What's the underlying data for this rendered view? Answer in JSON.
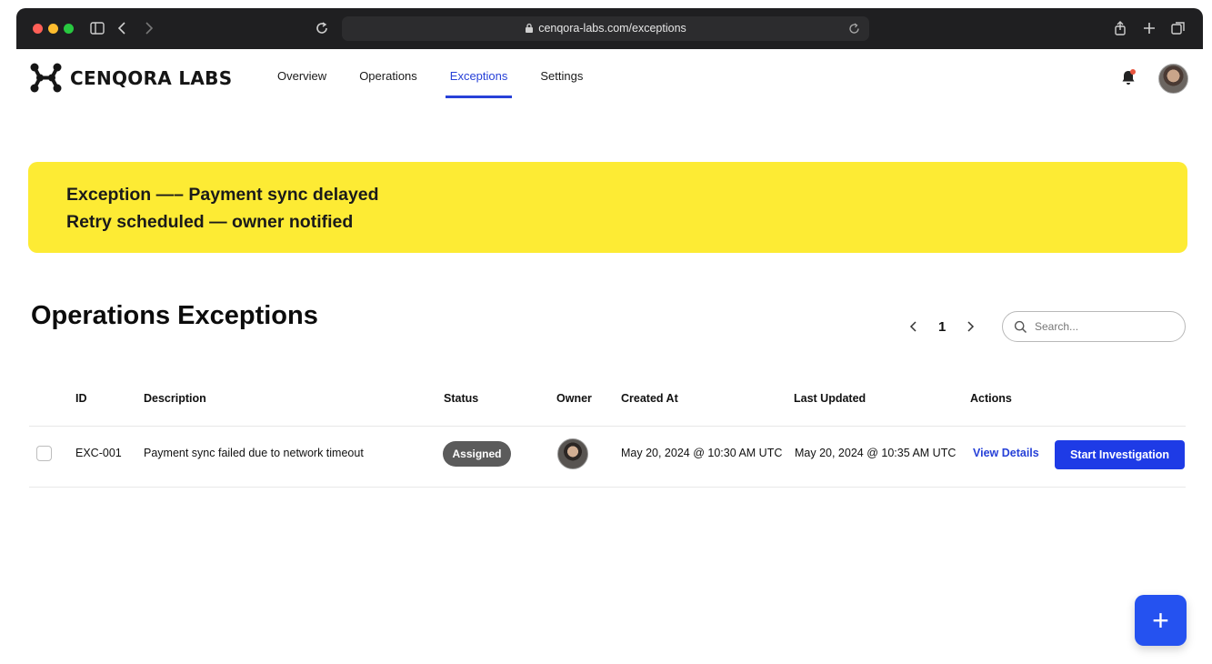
{
  "browser": {
    "url": "cenqora-labs.com/exceptions",
    "traffic_colors": [
      "#ff5f57",
      "#febc2e",
      "#28c840"
    ]
  },
  "header": {
    "logo_text": "CENQORA LABS",
    "nav": [
      {
        "label": "Overview",
        "active": false
      },
      {
        "label": "Operations",
        "active": false
      },
      {
        "label": "Exceptions",
        "active": true
      },
      {
        "label": "Settings",
        "active": false
      }
    ],
    "notification_dot_color": "#e8553f"
  },
  "banner": {
    "line1": "Exception —– Payment sync delayed",
    "line2": "Retry scheduled — owner notified",
    "color": "#fdeb34"
  },
  "section": {
    "title": "Operations Exceptions",
    "page": "1",
    "search_placeholder": "Search..."
  },
  "table": {
    "headers": {
      "id": "ID",
      "description": "Description",
      "status": "Status",
      "owner": "Owner",
      "created_at": "Created At",
      "last_updated": "Last Updated",
      "actions": "Actions"
    },
    "rows": [
      {
        "id": "EXC-001",
        "description": "Payment sync failed due to network timeout",
        "status": "Assigned",
        "created_at": "May 20, 2024 @ 10:30 AM UTC",
        "last_updated": "May 20, 2024 @ 10:35 AM UTC",
        "view_label": "View Details",
        "action_label": "Start Investigation"
      }
    ]
  },
  "fab": {
    "label": "+"
  },
  "colors": {
    "accent": "#2741d8",
    "button": "#1e3be6",
    "badge": "#5b5b5b"
  }
}
